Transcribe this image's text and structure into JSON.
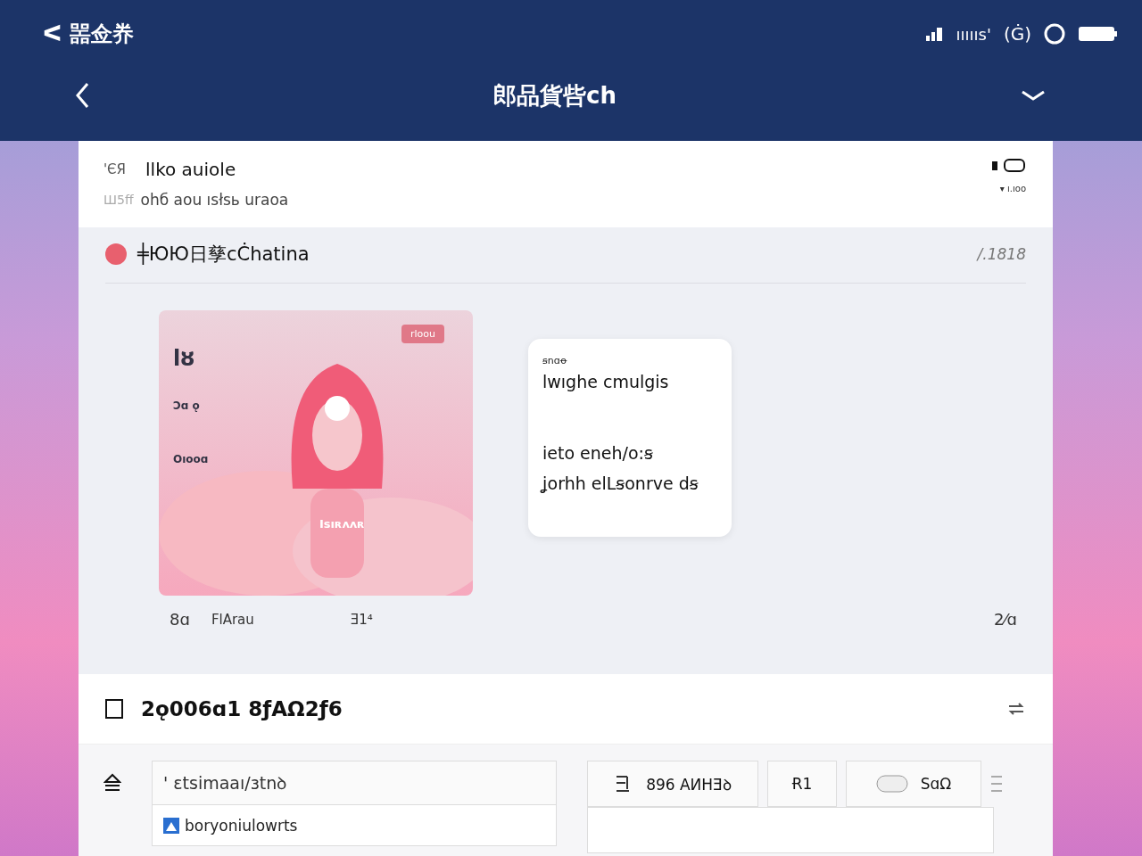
{
  "status_bar": {
    "left": "ᐸ 噐佥奍",
    "carrier": "ıııııs'",
    "network": "(Ġ)"
  },
  "nav": {
    "title": "郎品貨呰ch"
  },
  "profile": {
    "tag": "'ЄЯ",
    "name": "llko auiole",
    "meta": "Ш5ff",
    "subtitle": "ohб aou ısłsь uraoa",
    "signal": "▾ ı.ıoo"
  },
  "feed": {
    "title": "╪ЮЮ日孳cĊhatina",
    "count": "/.1818",
    "poster": {
      "kind": "picture",
      "badge": "rloou",
      "caption": "Isıʀʌʌʀ",
      "side_labels": [
        "lȣ",
        "Ɔɑ ǫ",
        "Oıooɑ"
      ]
    },
    "card": {
      "label": "ꞩnɑꝋ",
      "lines": [
        "lwıghe cmulgis",
        "ieto eneh/o꞉ꞩ",
        "ʝorhh elLꞩonrve dꞩ"
      ]
    },
    "footer": [
      "8ɑ",
      "FlArau",
      "Ǝ1⁴",
      "2⁄ɑ"
    ]
  },
  "panel": {
    "title": "2ǫ006ɑ1 8ƒAΩ2ƒ6",
    "field": {
      "value": "ꞌ ɛtsimaaı/ɜtnꝺ"
    },
    "suggestion": "boryoniulowrts",
    "buttons": [
      {
        "kind": "text",
        "label": "896 AИHƎꝺ"
      },
      {
        "kind": "icon",
        "label": "Ɍ1"
      },
      {
        "kind": "toggle",
        "label": "SɑΩ"
      }
    ]
  }
}
